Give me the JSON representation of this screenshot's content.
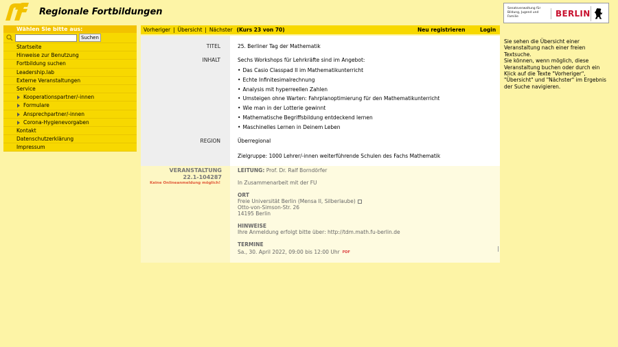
{
  "header": {
    "site_title": "Regionale Fortbildungen",
    "senate_text": "Senatsverwaltung für Bildung, Jugend und Familie",
    "berlin_word": "BERLIN",
    "brand_color": "#f2c200"
  },
  "nav": {
    "heading": "Wählen Sie bitte aus:",
    "search_placeholder": "",
    "search_button": "Suchen",
    "items": [
      {
        "label": "Startseite",
        "sub": false
      },
      {
        "label": "Hinweise zur Benutzung",
        "sub": false
      },
      {
        "label": "Fortbildung suchen",
        "sub": false
      },
      {
        "label": "Leadership.lab",
        "sub": false
      },
      {
        "label": "Externe Veranstaltungen",
        "sub": false
      },
      {
        "label": "Service",
        "sub": false
      },
      {
        "label": "Kooperationspartner/-innen",
        "sub": true
      },
      {
        "label": "Formulare",
        "sub": true
      },
      {
        "label": "Ansprechpartner/-innen",
        "sub": true
      },
      {
        "label": "Corona-Hygienevorgaben",
        "sub": true
      },
      {
        "label": "Kontakt",
        "sub": false
      },
      {
        "label": "Datenschutzerklärung",
        "sub": false
      },
      {
        "label": "Impressum",
        "sub": false
      }
    ]
  },
  "topbar": {
    "prev": "Vorheriger",
    "overview": "Übersicht",
    "next": "Nächster",
    "count": "(Kurs 23 von 70)",
    "register": "Neu registrieren",
    "login": "Login"
  },
  "course": {
    "title_label": "TITEL",
    "title": "25. Berliner Tag der Mathematik",
    "content_label": "INHALT",
    "intro": "Sechs Workshops für Lehrkräfte sind im Angebot:",
    "workshops": [
      "Das Casio Classpad II im Mathematikunterricht",
      "Echte Infinitesimalrechnung",
      "Analysis mit hyperreellen Zahlen",
      "Umsteigen ohne Warten: Fahrplanoptimierung für den Mathematikunterricht",
      "Wie man in der Lotterie gewinnt",
      "Mathematische Begriffsbildung entdeckend lernen",
      "Maschinelles Lernen in Deinem Leben"
    ],
    "region_label": "REGION",
    "region": "Überregional",
    "target": "Zielgruppe: 1000  Lehrer/-innen weiterführende Schulen des Fachs Mathematik"
  },
  "event": {
    "label": "VERANSTALTUNG",
    "number": "22.1-104287",
    "no_online": "Keine Onlineanmeldung möglich!",
    "leader_label": "LEITUNG:",
    "leader": "Prof. Dr. Ralf Borndörfer",
    "cooperation": "In Zusammenarbeit mit der FU",
    "place_label": "ORT",
    "place_name": "Freie Universität Berlin (Mensa II, Silberlaube)",
    "street": "Otto-von-Simson-Str. 26",
    "city": "14195 Berlin",
    "notes_label": "HINWEISE",
    "notes": "Ihre Anmeldung erfolgt bitte über: http://tdm.math.fu-berlin.de",
    "dates_label": "TERMINE",
    "date": "Sa., 30. April 2022, 09:00 bis 12:00 Uhr",
    "pdf_label": "PDF"
  },
  "info": {
    "text1": "Sie sehen die Übersicht einer Veranstaltung nach einer freien Textsuche.",
    "text2": "Sie können, wenn möglich, diese Veranstaltung buchen oder durch ein Klick auf die Texte \"Vorheriger\", \"Übersicht\" und \"Nächster\" im Ergebnis der Suche navigieren."
  }
}
